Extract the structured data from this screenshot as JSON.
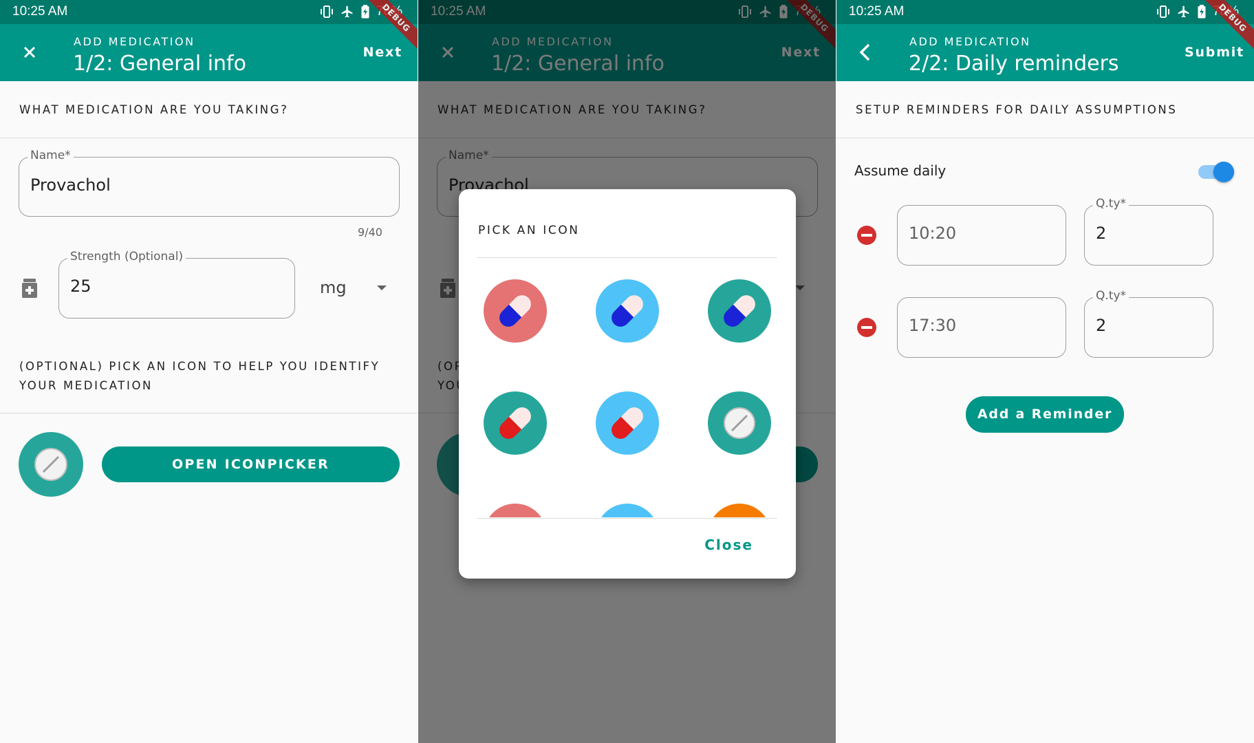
{
  "status_bar": {
    "time": "10:25 AM",
    "battery": "78%"
  },
  "debug_badge": "DEBUG",
  "colors": {
    "primary": "#009688",
    "primary_dark": "#00796b",
    "icon_teal": "#26a69a",
    "icon_red": "#e57373",
    "icon_blue": "#4fc3f7",
    "icon_orange": "#f57c00",
    "remove_red": "#d32f2f",
    "switch_blue": "#1e88e5"
  },
  "screen1": {
    "app_bar": {
      "subtitle": "ADD MEDICATION",
      "title": "1/2: General info",
      "action": "Next",
      "leading_icon": "close-icon"
    },
    "section1_heading": "WHAT MEDICATION ARE YOU TAKING?",
    "name_field": {
      "label": "Name*",
      "value": "Provachol",
      "counter": "9/40"
    },
    "strength_field": {
      "label": "Strength (Optional)",
      "value": "25",
      "leading_icon": "medicine-bottle-icon"
    },
    "unit_select": {
      "value": "mg"
    },
    "section2_heading_line1": "(OPTIONAL) PICK AN ICON TO HELP YOU IDENTIFY",
    "section2_heading_line2": "YOUR MEDICATION",
    "selected_icon": "tablet-icon",
    "open_iconpicker_label": "OPEN ICONPICKER"
  },
  "screen2": {
    "dialog": {
      "title": "PICK AN ICON",
      "icons": [
        {
          "name": "capsule-blue-on-red-icon",
          "bg": "#e57373",
          "capsule": "#1a23d6"
        },
        {
          "name": "capsule-blue-on-blue-icon",
          "bg": "#4fc3f7",
          "capsule": "#1a23d6"
        },
        {
          "name": "capsule-blue-on-teal-icon",
          "bg": "#26a69a",
          "capsule": "#1a23d6"
        },
        {
          "name": "capsule-red-on-teal-icon",
          "bg": "#26a69a",
          "capsule": "#e11d1d"
        },
        {
          "name": "capsule-red-on-blue-icon",
          "bg": "#4fc3f7",
          "capsule": "#e11d1d"
        },
        {
          "name": "tablet-on-teal-icon",
          "bg": "#26a69a",
          "capsule": ""
        },
        {
          "name": "partial-red-icon",
          "bg": "#e57373",
          "capsule": ""
        },
        {
          "name": "partial-blue-icon",
          "bg": "#4fc3f7",
          "capsule": ""
        },
        {
          "name": "partial-orange-icon",
          "bg": "#f57c00",
          "capsule": ""
        }
      ],
      "close_label": "Close"
    }
  },
  "screen3": {
    "app_bar": {
      "subtitle": "ADD MEDICATION",
      "title": "2/2: Daily reminders",
      "action": "Submit",
      "leading_icon": "back-arrow-icon"
    },
    "section_heading": "SETUP REMINDERS FOR DAILY ASSUMPTIONS",
    "assume_daily_label": "Assume daily",
    "assume_daily_on": true,
    "reminders": [
      {
        "time": "10:20",
        "qty_label": "Q.ty*",
        "qty": "2"
      },
      {
        "time": "17:30",
        "qty_label": "Q.ty*",
        "qty": "2"
      }
    ],
    "add_reminder_label": "Add a Reminder"
  }
}
